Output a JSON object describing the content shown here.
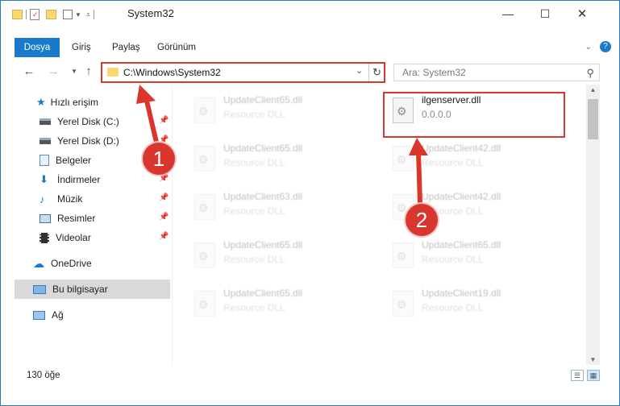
{
  "window": {
    "title": "System32",
    "controls": {
      "minimize": "—",
      "maximize": "☐",
      "close": "✕"
    }
  },
  "ribbon": {
    "tabs": [
      "Dosya",
      "Giriş",
      "Paylaş",
      "Görünüm"
    ]
  },
  "address": {
    "path": "C:\\Windows\\System32",
    "search_placeholder": "Ara: System32"
  },
  "sidebar": {
    "items": [
      {
        "label": "Hızlı erişim",
        "icon": "star-icon",
        "pinned": false
      },
      {
        "label": "Yerel Disk (C:)",
        "icon": "drive-icon",
        "pinned": true
      },
      {
        "label": "Yerel Disk (D:)",
        "icon": "drive-icon",
        "pinned": true
      },
      {
        "label": "Belgeler",
        "icon": "documents-icon",
        "pinned": true
      },
      {
        "label": "İndirmeler",
        "icon": "download-icon",
        "pinned": true
      },
      {
        "label": "Müzik",
        "icon": "music-icon",
        "pinned": true
      },
      {
        "label": "Resimler",
        "icon": "pictures-icon",
        "pinned": true
      },
      {
        "label": "Videolar",
        "icon": "videos-icon",
        "pinned": true
      },
      {
        "label": "OneDrive",
        "icon": "cloud-icon",
        "pinned": false
      },
      {
        "label": "Bu bilgisayar",
        "icon": "computer-icon",
        "pinned": false,
        "selected": true
      },
      {
        "label": "Ağ",
        "icon": "network-icon",
        "pinned": false
      }
    ]
  },
  "files": {
    "left_column": [
      {
        "name": "UpdateClient65.dll",
        "desc": "Resource DLL"
      },
      {
        "name": "UpdateClient65.dll",
        "desc": "Resource DLL"
      },
      {
        "name": "UpdateClient63.dll",
        "desc": "Resource DLL"
      },
      {
        "name": "UpdateClient65.dll",
        "desc": "Resource DLL"
      },
      {
        "name": "UpdateClient65.dll",
        "desc": "Resource DLL"
      }
    ],
    "right_column": [
      {
        "name": "ilgenserver.dll",
        "desc": "0.0.0.0"
      },
      {
        "name": "UpdateClient42.dll",
        "desc": "Resource DLL"
      },
      {
        "name": "UpdateClient42.dll",
        "desc": "Resource DLL"
      },
      {
        "name": "UpdateClient65.dll",
        "desc": "Resource DLL"
      },
      {
        "name": "UpdateClient19.dll",
        "desc": "Resource DLL"
      }
    ]
  },
  "status": {
    "item_count": "130 öğe"
  },
  "annotations": {
    "step1": "1",
    "step2": "2"
  },
  "colors": {
    "accent": "#1979ca",
    "callout": "#d9372e",
    "selected_nav": "#d9d9d9"
  }
}
